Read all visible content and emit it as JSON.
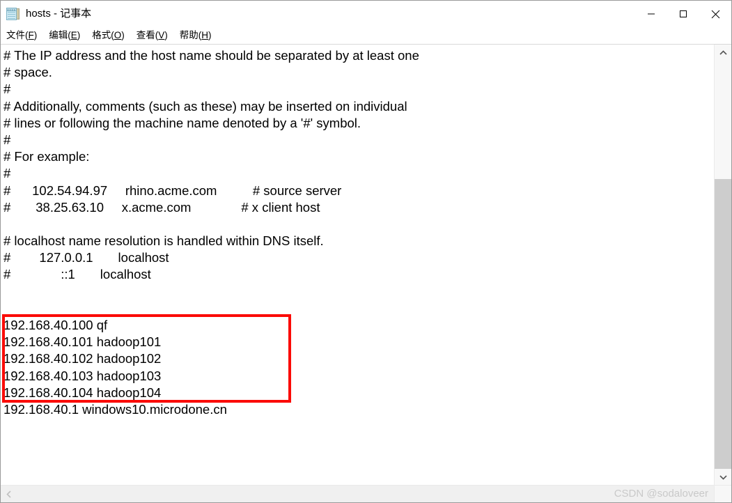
{
  "window": {
    "title": "hosts - 记事本",
    "icon": "notepad-icon",
    "controls": {
      "minimize": "—",
      "maximize": "□",
      "close": "✕"
    }
  },
  "menubar": {
    "items": [
      {
        "label": "文件(F)",
        "text": "文件(",
        "accel": "F",
        "tail": ")"
      },
      {
        "label": "编辑(E)",
        "text": "编辑(",
        "accel": "E",
        "tail": ")"
      },
      {
        "label": "格式(O)",
        "text": "格式(",
        "accel": "O",
        "tail": ")"
      },
      {
        "label": "查看(V)",
        "text": "查看(",
        "accel": "V",
        "tail": ")"
      },
      {
        "label": "帮助(H)",
        "text": "帮助(",
        "accel": "H",
        "tail": ")"
      }
    ]
  },
  "editor": {
    "lines": [
      "# The IP address and the host name should be separated by at least one",
      "# space.",
      "#",
      "# Additionally, comments (such as these) may be inserted on individual",
      "# lines or following the machine name denoted by a '#' symbol.",
      "#",
      "# For example:",
      "#",
      "#      102.54.94.97     rhino.acme.com          # source server",
      "#       38.25.63.10     x.acme.com              # x client host",
      "",
      "# localhost name resolution is handled within DNS itself.",
      "#        127.0.0.1       localhost",
      "#              ::1       localhost",
      "",
      "",
      "192.168.40.100 qf",
      "192.168.40.101 hadoop101",
      "192.168.40.102 hadoop102",
      "192.168.40.103 hadoop103",
      "192.168.40.104 hadoop104",
      "192.168.40.1 windows10.microdone.cn"
    ]
  },
  "annotation": {
    "color": "#fb0b06",
    "highlighted_lines": [
      "192.168.40.100 qf",
      "192.168.40.101 hadoop101",
      "192.168.40.102 hadoop102",
      "192.168.40.103 hadoop103",
      "192.168.40.104 hadoop104"
    ]
  },
  "scrollbars": {
    "vertical": {
      "up_arrow": "⌃",
      "down_arrow": "⌄"
    },
    "horizontal": {
      "left_arrow": "‹"
    }
  },
  "watermark": {
    "text": "CSDN @sodaloveer"
  }
}
